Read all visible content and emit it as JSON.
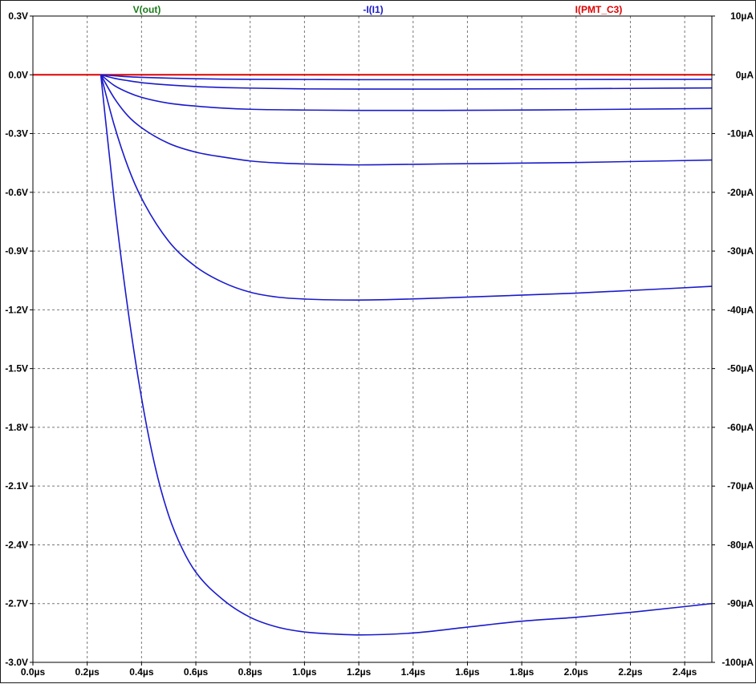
{
  "chart_data": {
    "type": "line",
    "legend": [
      {
        "label": "V(out)",
        "color": "#1a7a1a",
        "axis": "left"
      },
      {
        "label": "-I(I1)",
        "color": "#1a1acc",
        "axis": "right"
      },
      {
        "label": "I(PMT_C3)",
        "color": "#e00000",
        "axis": "right"
      }
    ],
    "legend_placement": "top",
    "grid": true,
    "x_axis": {
      "range": [
        0.0,
        2.5
      ],
      "unit": "µs",
      "ticks": [
        0.0,
        0.2,
        0.4,
        0.6,
        0.8,
        1.0,
        1.2,
        1.4,
        1.6,
        1.8,
        2.0,
        2.2,
        2.4
      ],
      "tick_labels": [
        "0.0µs",
        "0.2µs",
        "0.4µs",
        "0.6µs",
        "0.8µs",
        "1.0µs",
        "1.2µs",
        "1.4µs",
        "1.6µs",
        "1.8µs",
        "2.0µs",
        "2.2µs",
        "2.4µs"
      ]
    },
    "y_left": {
      "range": [
        -3.0,
        0.3
      ],
      "ticks": [
        0.3,
        0.0,
        -0.3,
        -0.6,
        -0.9,
        -1.2,
        -1.5,
        -1.8,
        -2.1,
        -2.4,
        -2.7,
        -3.0
      ],
      "tick_labels": [
        "0.3V",
        "0.0V",
        "-0.3V",
        "-0.6V",
        "-0.9V",
        "-1.2V",
        "-1.5V",
        "-1.8V",
        "-2.1V",
        "-2.4V",
        "-2.7V",
        "-3.0V"
      ]
    },
    "y_right": {
      "range": [
        -100,
        10
      ],
      "ticks": [
        10,
        0,
        -10,
        -20,
        -30,
        -40,
        -50,
        -60,
        -70,
        -80,
        -90,
        -100
      ],
      "tick_labels": [
        "10µA",
        "0µA",
        "-10µA",
        "-20µA",
        "-30µA",
        "-40µA",
        "-50µA",
        "-60µA",
        "-70µA",
        "-80µA",
        "-90µA",
        "-100µA"
      ]
    },
    "series": [
      {
        "color": "#e00000",
        "x": [
          0.0,
          0.25,
          2.5
        ],
        "y": [
          0.0,
          0.0,
          0.0
        ]
      },
      {
        "color": "#1a1acc",
        "x": [
          0.25,
          0.3,
          0.35,
          0.4,
          0.5,
          0.6,
          0.7,
          0.8,
          1.0,
          1.2,
          1.5,
          2.0,
          2.5
        ],
        "y": [
          0.0,
          -0.005,
          -0.01,
          -0.013,
          -0.017,
          -0.02,
          -0.022,
          -0.023,
          -0.024,
          -0.025,
          -0.025,
          -0.024,
          -0.023
        ]
      },
      {
        "color": "#1a1acc",
        "x": [
          0.25,
          0.3,
          0.35,
          0.4,
          0.5,
          0.6,
          0.7,
          0.8,
          1.0,
          1.2,
          1.5,
          2.0,
          2.5
        ],
        "y": [
          0.0,
          -0.018,
          -0.03,
          -0.04,
          -0.052,
          -0.06,
          -0.065,
          -0.068,
          -0.072,
          -0.073,
          -0.073,
          -0.071,
          -0.067
        ]
      },
      {
        "color": "#1a1acc",
        "x": [
          0.25,
          0.3,
          0.35,
          0.4,
          0.5,
          0.6,
          0.7,
          0.8,
          1.0,
          1.2,
          1.5,
          2.0,
          2.5
        ],
        "y": [
          0.0,
          -0.055,
          -0.09,
          -0.115,
          -0.145,
          -0.16,
          -0.17,
          -0.176,
          -0.18,
          -0.182,
          -0.182,
          -0.178,
          -0.172
        ]
      },
      {
        "color": "#1a1acc",
        "x": [
          0.25,
          0.3,
          0.35,
          0.4,
          0.5,
          0.6,
          0.7,
          0.8,
          0.9,
          1.0,
          1.2,
          1.5,
          2.0,
          2.5
        ],
        "y": [
          0.0,
          -0.12,
          -0.21,
          -0.27,
          -0.35,
          -0.395,
          -0.42,
          -0.44,
          -0.45,
          -0.455,
          -0.46,
          -0.455,
          -0.448,
          -0.435
        ]
      },
      {
        "color": "#1a1acc",
        "x": [
          0.25,
          0.3,
          0.35,
          0.4,
          0.5,
          0.6,
          0.7,
          0.8,
          0.9,
          1.0,
          1.2,
          1.5,
          2.0,
          2.5
        ],
        "y": [
          0.0,
          -0.26,
          -0.47,
          -0.63,
          -0.85,
          -0.98,
          -1.06,
          -1.11,
          -1.135,
          -1.145,
          -1.15,
          -1.14,
          -1.115,
          -1.08
        ]
      },
      {
        "color": "#1a1acc",
        "x": [
          0.25,
          0.3,
          0.35,
          0.4,
          0.45,
          0.5,
          0.55,
          0.6,
          0.7,
          0.8,
          0.9,
          1.0,
          1.1,
          1.2,
          1.4,
          1.6,
          1.8,
          2.0,
          2.2,
          2.5
        ],
        "y": [
          0.0,
          -0.65,
          -1.2,
          -1.65,
          -2.0,
          -2.25,
          -2.42,
          -2.54,
          -2.68,
          -2.77,
          -2.82,
          -2.845,
          -2.855,
          -2.86,
          -2.85,
          -2.82,
          -2.79,
          -2.77,
          -2.745,
          -2.7
        ]
      }
    ]
  }
}
